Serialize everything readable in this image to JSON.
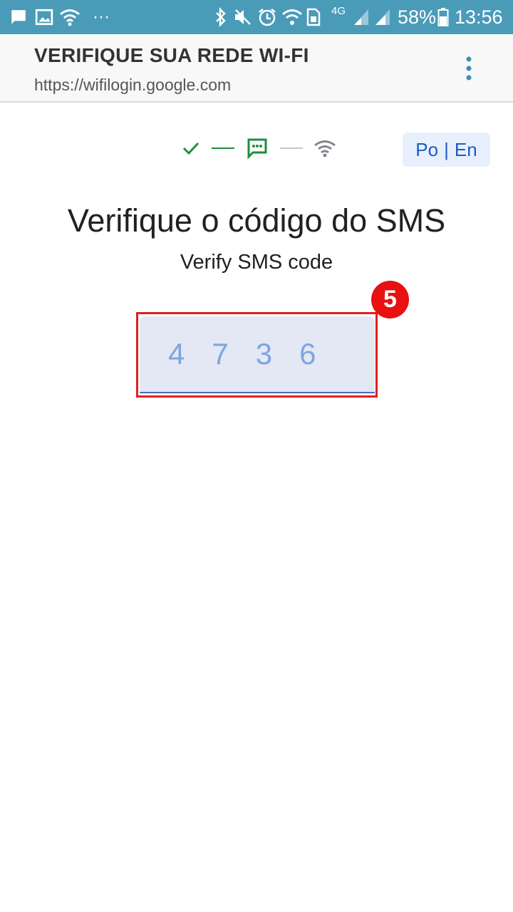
{
  "status_bar": {
    "battery": "58%",
    "time": "13:56",
    "network": "4G",
    "overflow": "···",
    "icons": [
      "message-icon",
      "image-icon",
      "wifi-icon",
      "bluetooth-icon",
      "mute-icon",
      "alarm-icon",
      "wifi-calling-icon",
      "sim-icon",
      "signal-icon",
      "battery-icon"
    ]
  },
  "browser": {
    "title": "VERIFIQUE SUA REDE WI-FI",
    "url": "https://wifilogin.google.com",
    "menu_icon": "more-vert-icon"
  },
  "stepper": {
    "steps": [
      "check-icon",
      "sms-icon",
      "wifi-icon"
    ],
    "completed_color": "#1e8e3e",
    "pending_color": "#80868b"
  },
  "language": {
    "portuguese": "Po",
    "separator": "|",
    "english": "En"
  },
  "main": {
    "title": "Verifique o código do SMS",
    "subtitle": "Verify SMS code",
    "code_value": "4736"
  },
  "annotation": {
    "badge": "5",
    "color": "#e02020"
  }
}
